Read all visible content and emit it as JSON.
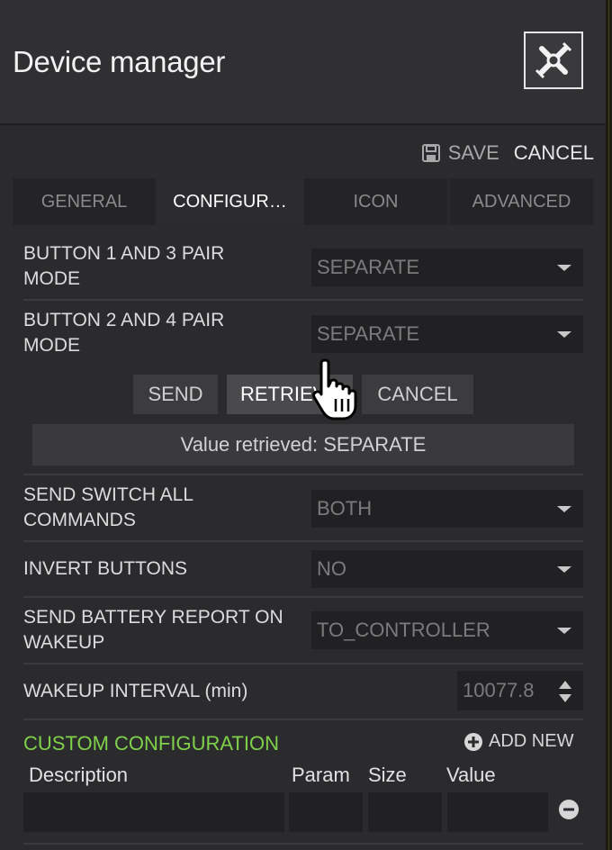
{
  "window": {
    "title": "Device manager",
    "logo_icon": "satellite-logo-icon"
  },
  "actions": {
    "save_label": "SAVE",
    "cancel_label": "CANCEL"
  },
  "tabs": [
    {
      "label": "GENERAL",
      "active": false
    },
    {
      "label": "CONFIGUR…",
      "active": true
    },
    {
      "label": "ICON",
      "active": false
    },
    {
      "label": "ADVANCED",
      "active": false
    }
  ],
  "config": {
    "button13": {
      "label": "BUTTON 1 AND 3 PAIR MODE",
      "value": "SEPARATE"
    },
    "button24": {
      "label": "BUTTON 2 AND 4 PAIR MODE",
      "value": "SEPARATE"
    },
    "param_buttons": {
      "send": "SEND",
      "retrieve": "RETRIEVE",
      "cancel": "CANCEL"
    },
    "status": "Value retrieved: SEPARATE",
    "switch_all": {
      "label": "SEND SWITCH ALL COMMANDS",
      "value": "BOTH"
    },
    "invert": {
      "label": "INVERT BUTTONS",
      "value": "NO"
    },
    "battery": {
      "label": "SEND BATTERY REPORT ON WAKEUP",
      "value": "TO_CONTROLLER"
    },
    "wakeup": {
      "label": "WAKEUP INTERVAL (min)",
      "value": "10077.8"
    }
  },
  "custom": {
    "title": "CUSTOM CONFIGURATION",
    "add_label": "ADD NEW",
    "columns": [
      "Description",
      "Param",
      "Size",
      "Value"
    ]
  },
  "colors": {
    "accent_green": "#7fd14a",
    "background": "#2b2b2d"
  }
}
